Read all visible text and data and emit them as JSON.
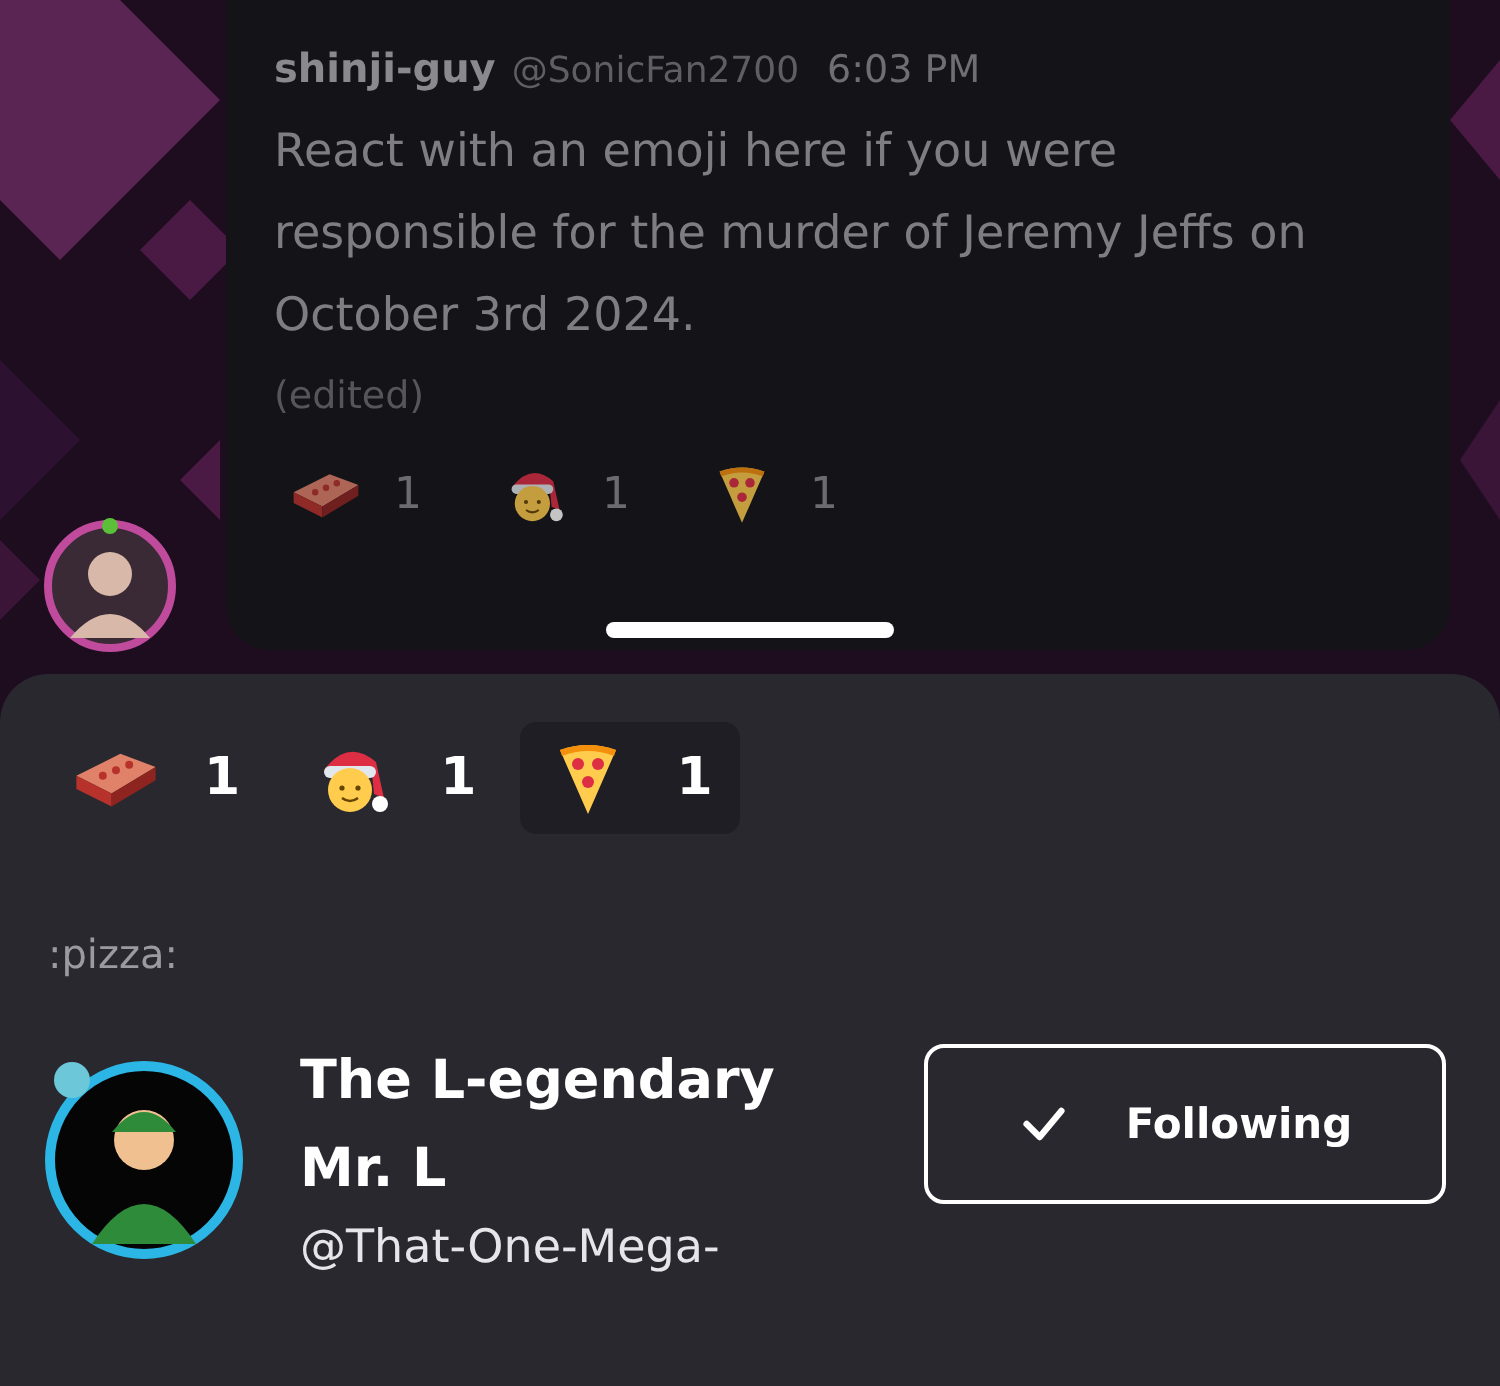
{
  "message": {
    "author": "shinji-guy",
    "handle": "@SonicFan2700",
    "time": "6:03 PM",
    "text": "React with an emoji here if you were responsible for the murder of Jeremy Jeffs on October 3rd 2024.",
    "edited": "(edited)",
    "reactions": [
      {
        "kind": "brick",
        "count": "1"
      },
      {
        "kind": "santa",
        "count": "1"
      },
      {
        "kind": "pizza",
        "count": "1"
      }
    ]
  },
  "sheet": {
    "reactions": [
      {
        "kind": "brick",
        "count": "1",
        "selected": false
      },
      {
        "kind": "santa",
        "count": "1",
        "selected": false
      },
      {
        "kind": "pizza",
        "count": "1",
        "selected": true
      }
    ],
    "emoji_name": ":pizza:",
    "user": {
      "name": "The L-egendary Mr. L",
      "handle": "@That-One-Mega-"
    },
    "follow_button": {
      "label": "Following",
      "following": true
    }
  }
}
